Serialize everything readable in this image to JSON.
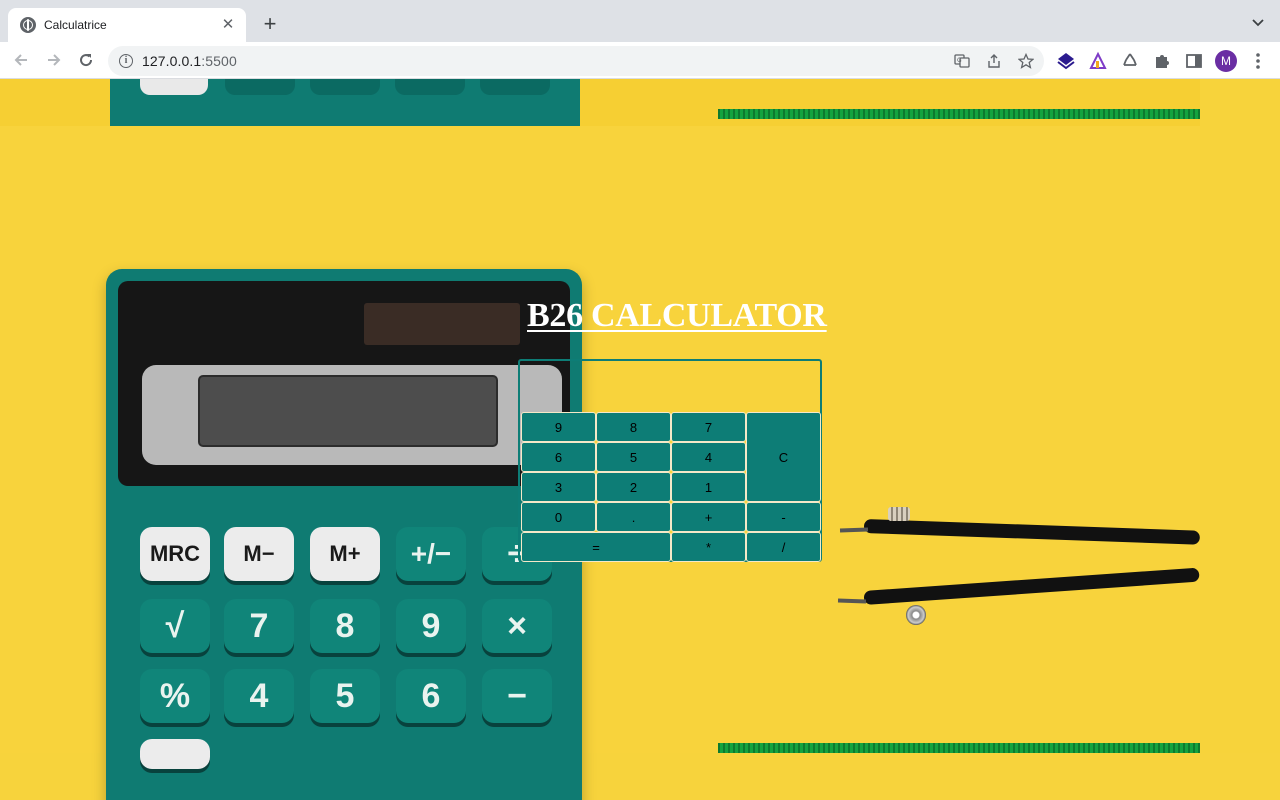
{
  "browser": {
    "tab_title": "Calculatrice",
    "url_host": "127.0.0.1",
    "url_port": ":5500",
    "profile_initial": "M"
  },
  "page": {
    "heading": "B26 CALCULATOR",
    "display_value": ""
  },
  "keypad": {
    "rows": [
      [
        "9",
        "8",
        "7",
        "C"
      ],
      [
        "6",
        "5",
        "4"
      ],
      [
        "3",
        "2",
        "1"
      ],
      [
        "0",
        ".",
        "+",
        "-"
      ],
      [
        "=",
        "*",
        "/"
      ]
    ]
  },
  "colors": {
    "accent": "#0d7d76",
    "page_background": "#f8d33c",
    "heading": "#ffffff"
  },
  "icons": [
    "globe-favicon",
    "close-icon",
    "plus-icon",
    "chevron-down-icon",
    "back-arrow-icon",
    "forward-arrow-icon",
    "reload-icon",
    "info-icon",
    "translate-icon",
    "share-icon",
    "star-icon",
    "extension-icons",
    "puzzle-icon",
    "side-panel-icon",
    "kebab-menu-icon"
  ]
}
